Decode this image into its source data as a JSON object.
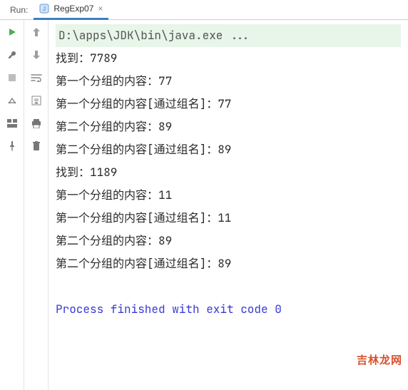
{
  "topbar": {
    "run_label": "Run:",
    "tab_label": "RegExp07",
    "close_glyph": "×"
  },
  "icons": {
    "run": "run-icon",
    "wrench": "wrench-icon",
    "stop": "stop-icon",
    "debug": "debug-icon",
    "layout": "layout-icon",
    "pin": "pin-icon",
    "up": "up-arrow-icon",
    "down": "down-arrow-icon",
    "wrap": "wrap-icon",
    "scroll": "scroll-end-icon",
    "print": "print-icon",
    "trash": "trash-icon"
  },
  "console": {
    "command": "D:\\apps\\JDK\\bin\\java.exe ...",
    "lines": [
      "找到：7789",
      "第一个分组的内容：77",
      "第一个分组的内容[通过组名]：77",
      "第二个分组的内容：89",
      "第二个分组的内容[通过组名]：89",
      "找到：1189",
      "第一个分组的内容：11",
      "第一个分组的内容[通过组名]：11",
      "第二个分组的内容：89",
      "第二个分组的内容[通过组名]：89"
    ],
    "exit_line": "Process finished with exit code 0"
  },
  "watermark": "吉林龙网"
}
